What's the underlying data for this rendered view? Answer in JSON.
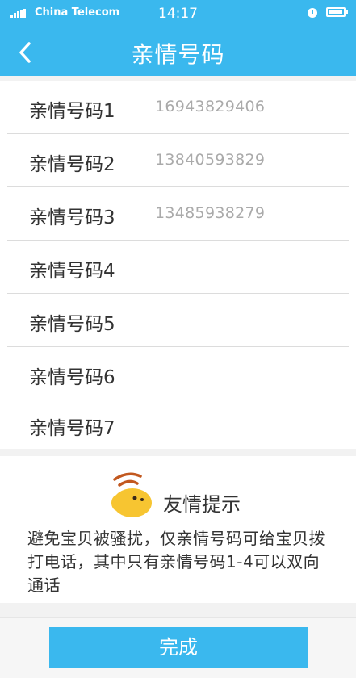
{
  "status_bar": {
    "carrier": "China Telecom",
    "time": "14:17"
  },
  "header": {
    "title": "亲情号码"
  },
  "family_numbers": [
    {
      "label": "亲情号码1",
      "number": "16943829406"
    },
    {
      "label": "亲情号码2",
      "number": "13840593829"
    },
    {
      "label": "亲情号码3",
      "number": "13485938279"
    },
    {
      "label": "亲情号码4",
      "number": ""
    },
    {
      "label": "亲情号码5",
      "number": ""
    },
    {
      "label": "亲情号码6",
      "number": ""
    },
    {
      "label": "亲情号码7",
      "number": ""
    }
  ],
  "tip": {
    "title": "友情提示",
    "body": "避免宝贝被骚扰，仅亲情号码可给宝贝拨打电话，其中只有亲情号码1-4可以双向通话"
  },
  "footer": {
    "done_label": "完成"
  },
  "colors": {
    "accent": "#3ab8ee",
    "mascot": "#f7c531"
  }
}
